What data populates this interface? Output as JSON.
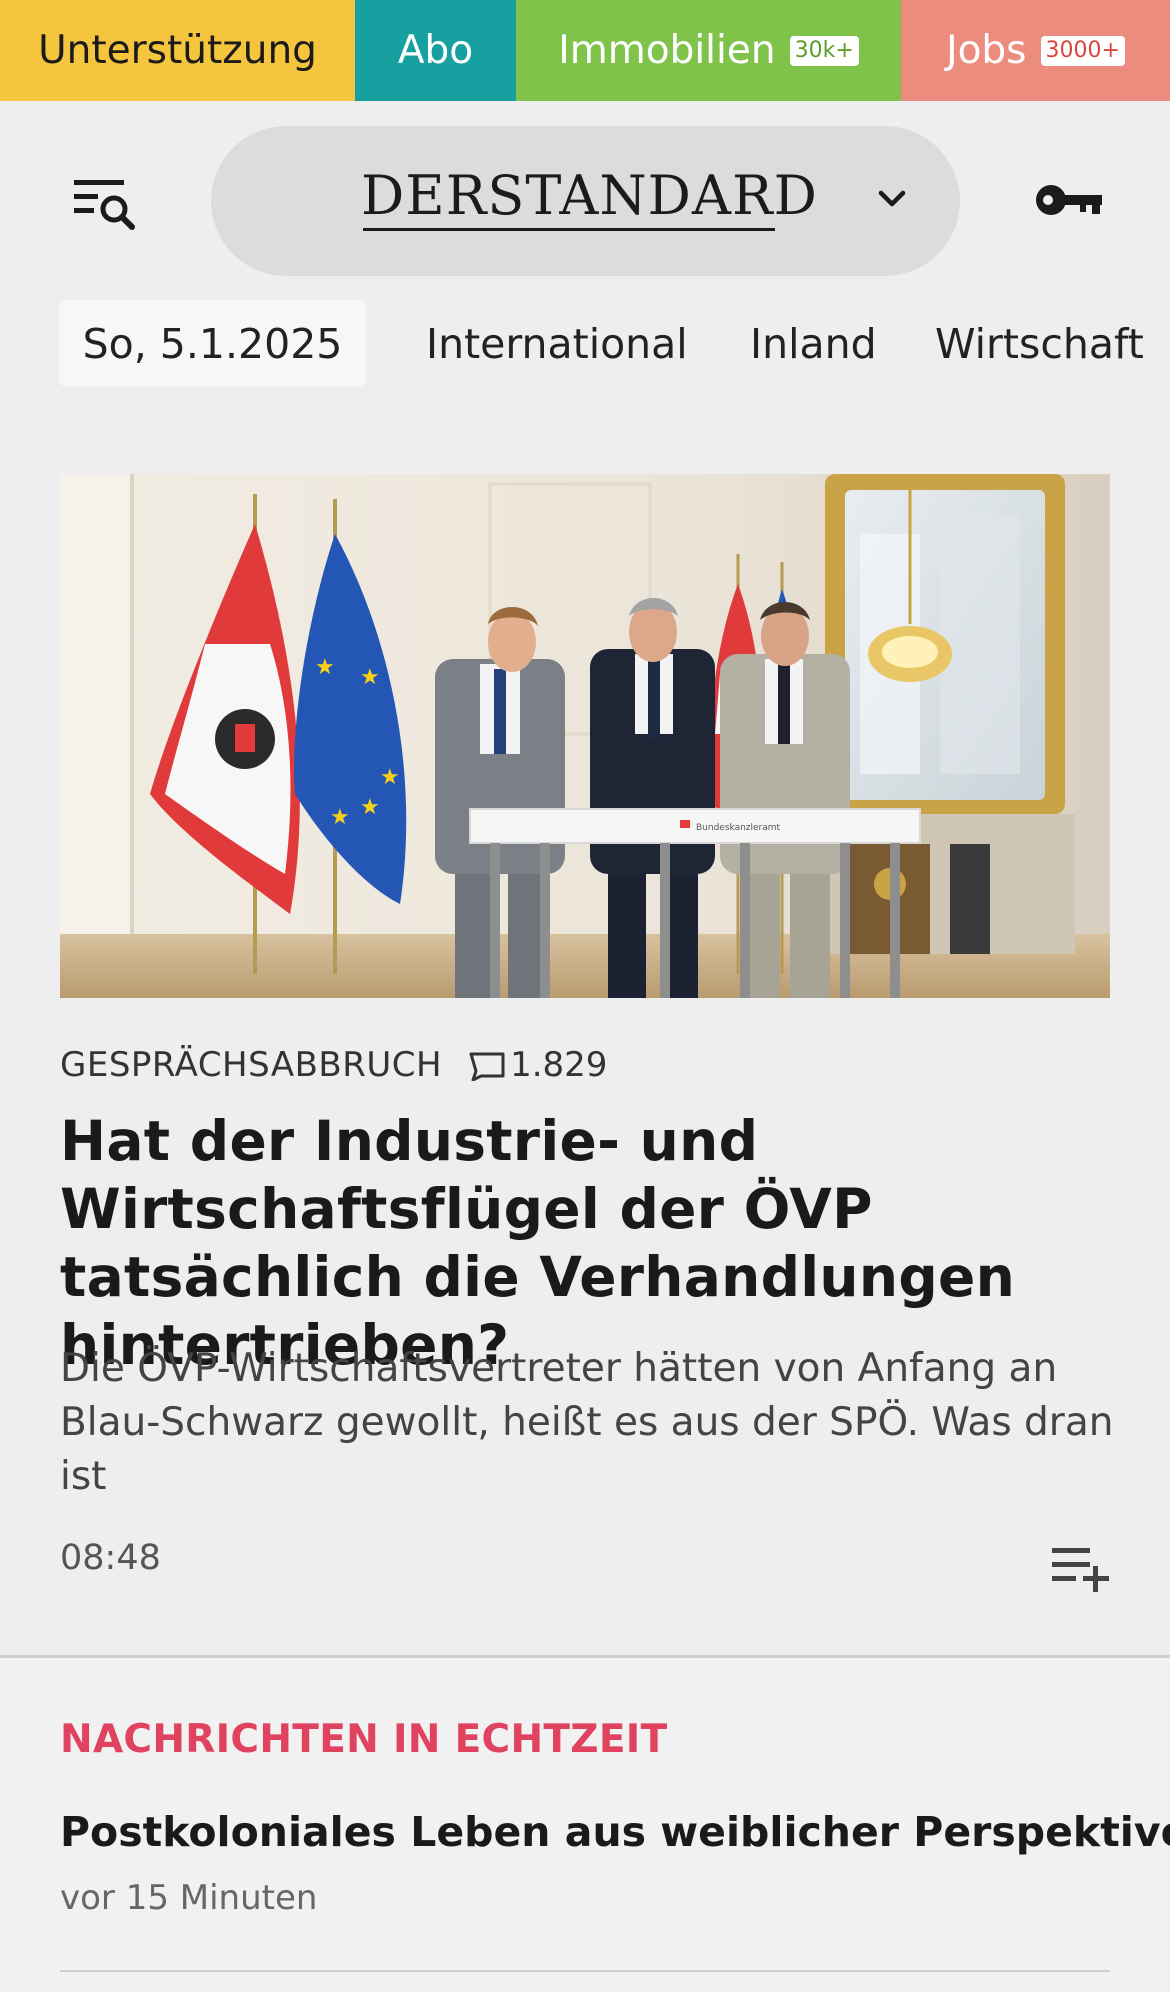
{
  "topbar": {
    "support": "Unterstützung",
    "abo": "Abo",
    "immobilien": "Immobilien",
    "immobilien_badge": "30k+",
    "jobs": "Jobs",
    "jobs_badge": "3000+"
  },
  "header": {
    "logo": "DERSTANDARD",
    "menu_icon": "menu-search-icon",
    "chevron_icon": "chevron-down-icon",
    "login_icon": "key-icon"
  },
  "nav": {
    "date": "So, 5.1.2025",
    "items": [
      "International",
      "Inland",
      "Wirtschaft"
    ]
  },
  "article": {
    "kicker": "GESPRÄCHSABBRUCH",
    "comments": "1.829",
    "headline": "Hat der Industrie- und Wirtschafts­flügel der ÖVP tatsächlich die Verhandlungen hintertrieben?",
    "teaser": "Die ÖVP-Wirtschaftsvertreter hätten von Anfang an Blau-Schwarz gewollt, heißt es aus der SPÖ. Was dran ist",
    "time": "08:48",
    "podium_label": "Bundeskanzleramt"
  },
  "live": {
    "title": "NACHRICHTEN IN ECHTZEIT",
    "headline": "Postkoloniales Leben aus weiblicher Perspektive",
    "time": "vor 15 Minuten"
  },
  "colors": {
    "support": "#f6c53e",
    "abo": "#16a0a0",
    "immobilien": "#7fc34a",
    "jobs": "#ec8c7f",
    "live_accent": "#e0435f"
  }
}
